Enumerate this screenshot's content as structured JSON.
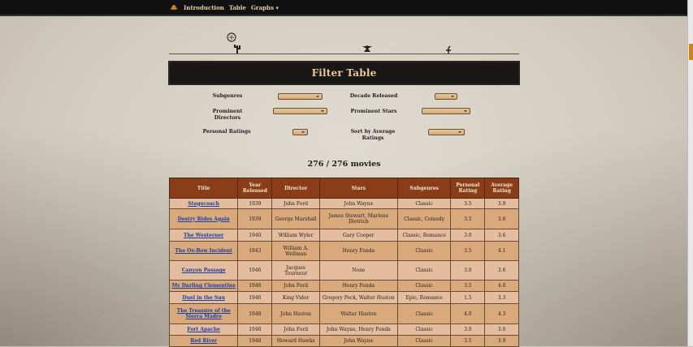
{
  "nav": {
    "items": [
      "Introduction",
      "Table",
      "Graphs ▾"
    ]
  },
  "header": {
    "title": "Filter Table"
  },
  "filters": {
    "subgenres": "Subgenres",
    "decade": "Decade Released",
    "directors": "Prominent Directors",
    "stars": "Prominent Stars",
    "personal": "Personal Ratings",
    "sort": "Sort by Average Ratings"
  },
  "count": "276 / 276 movies",
  "table": {
    "headers": [
      "Title",
      "Year Released",
      "Director",
      "Stars",
      "Subgenres",
      "Personal Rating",
      "Average Rating"
    ],
    "rows": [
      [
        "Stagecoach",
        "1939",
        "John Ford",
        "John Wayne",
        "Classic",
        "3.5",
        "3.9"
      ],
      [
        "Destry Rides Again",
        "1939",
        "George Marshall",
        "James Stewart, Marlene Dietrich",
        "Classic, Comedy",
        "3.5",
        "3.6"
      ],
      [
        "The Westerner",
        "1940",
        "William Wyler",
        "Gary Cooper",
        "Classic, Romance",
        "3.0",
        "3.6"
      ],
      [
        "The Ox-Bow Incident",
        "1943",
        "William A. Wellman",
        "Henry Fonda",
        "Classic",
        "3.5",
        "4.1"
      ],
      [
        "Canyon Passage",
        "1946",
        "Jacques Tourneur",
        "None",
        "Classic",
        "3.0",
        "3.6"
      ],
      [
        "My Darling Clementine",
        "1946",
        "John Ford",
        "Henry Fonda",
        "Classic",
        "3.5",
        "4.0"
      ],
      [
        "Duel in the Sun",
        "1946",
        "King Vidor",
        "Gregory Peck, Walter Huston",
        "Epic, Romance",
        "1.5",
        "3.3"
      ],
      [
        "The Treasure of the Sierra Madre",
        "1948",
        "John Huston",
        "Walter Huston",
        "Classic",
        "4.0",
        "4.3"
      ],
      [
        "Fort Apache",
        "1948",
        "John Ford",
        "John Wayne, Henry Fonda",
        "Classic",
        "3.0",
        "3.0"
      ],
      [
        "Red River",
        "1948",
        "Howard Hawks",
        "John Wayne",
        "Classic",
        "3.5",
        "3.9"
      ]
    ]
  }
}
